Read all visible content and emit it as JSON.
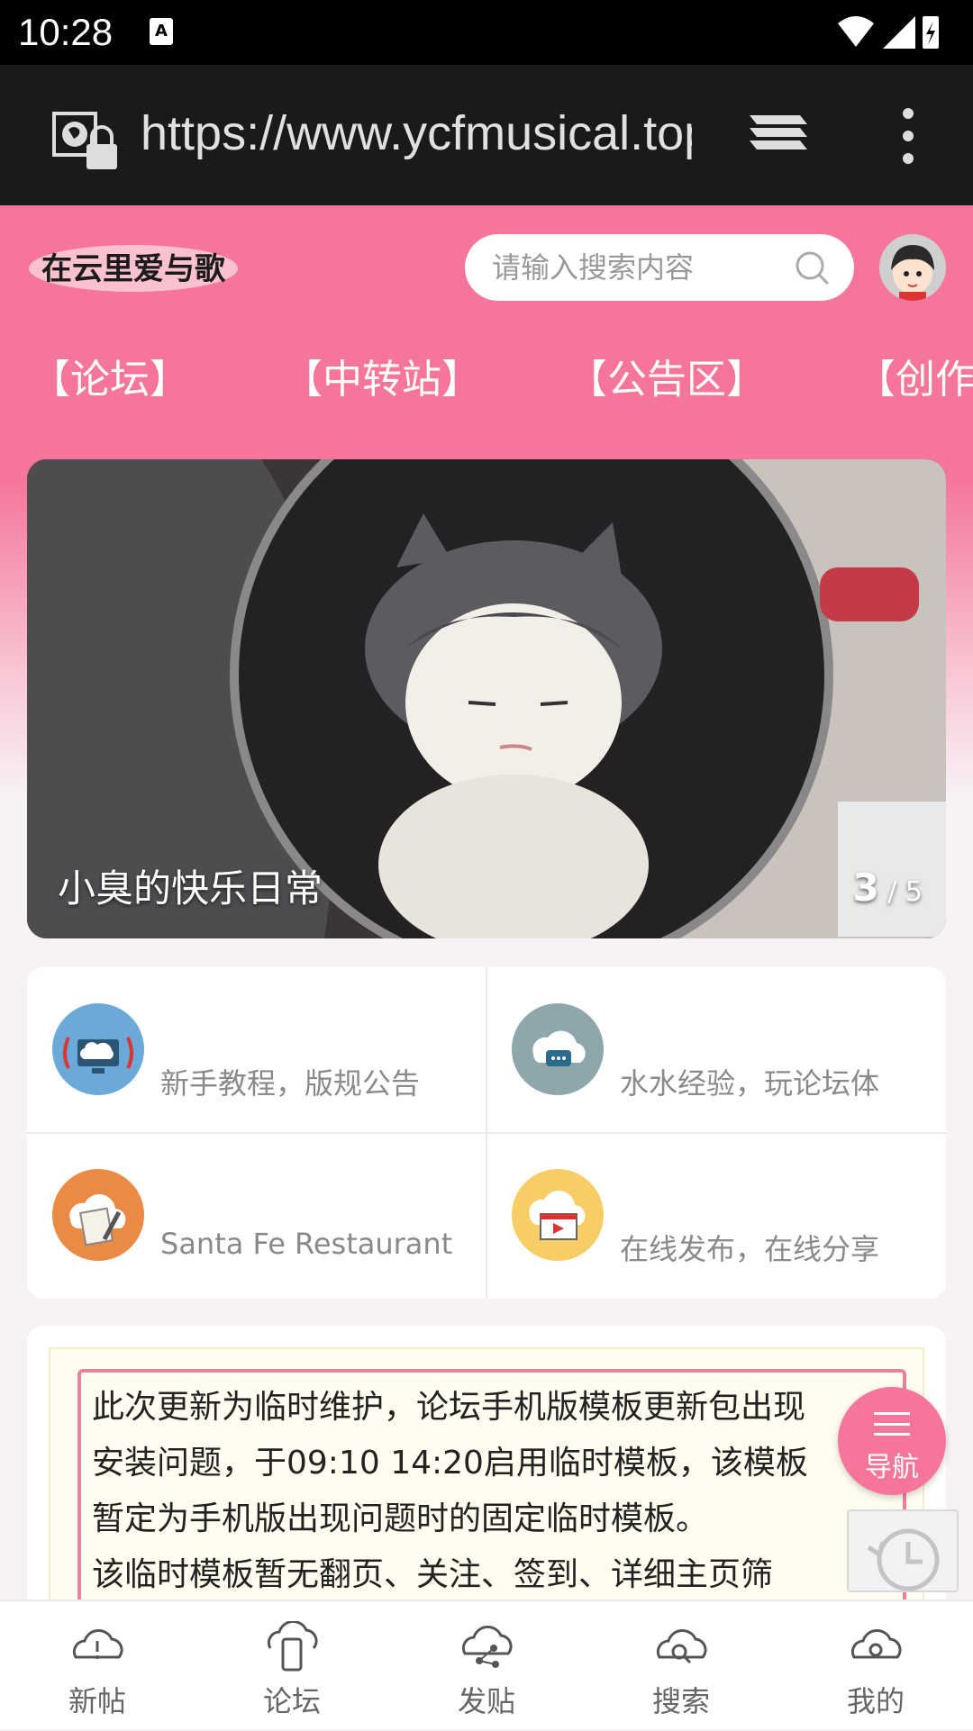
{
  "status_bar": {
    "time": "10:28",
    "notification_glyph": "A"
  },
  "browser": {
    "url": "https://www.ycfmusical.top"
  },
  "header": {
    "logo_text": "在云里爱与歌",
    "search_placeholder": "请输入搜索内容"
  },
  "nav_tabs": [
    {
      "label": "【论坛】"
    },
    {
      "label": "【中转站】"
    },
    {
      "label": "【公告区】"
    },
    {
      "label": "【创作"
    }
  ],
  "banner": {
    "caption": "小臭的快乐日常",
    "current": "3",
    "total": "/ 5"
  },
  "categories": [
    {
      "text": "新手教程，版规公告",
      "icon": "broadcast-tv-icon",
      "color": "#6aa9d8"
    },
    {
      "text": "水水经验，玩论坛体",
      "icon": "chat-bubble-cloud-icon",
      "color": "#8fa6ad"
    },
    {
      "text": "Santa Fe Restaurant",
      "icon": "document-edit-icon",
      "color": "#ea8a45"
    },
    {
      "text": "在线发布，在线分享",
      "icon": "video-player-icon",
      "color": "#f9cd66"
    }
  ],
  "notice": {
    "lines": [
      "此次更新为临时维护，论坛手机版模板更新包出现",
      "安装问题，于09:10  14:20启用临时模板，该模板",
      "暂定为手机版出现问题时的固定临时模板。",
      "该临时模板暂无翻页、关注、签到、详细主页筛"
    ]
  },
  "fab": {
    "label": "导航"
  },
  "bottom_nav": [
    {
      "label": "新帖",
      "icon": "cloud-alert-icon"
    },
    {
      "label": "论坛",
      "icon": "cloud-phone-icon"
    },
    {
      "label": "发贴",
      "icon": "cloud-share-icon"
    },
    {
      "label": "搜索",
      "icon": "cloud-search-icon"
    },
    {
      "label": "我的",
      "icon": "cloud-user-icon"
    }
  ],
  "colors": {
    "brand_pink": "#f5769a",
    "browser_bar": "#1a1a1a"
  }
}
